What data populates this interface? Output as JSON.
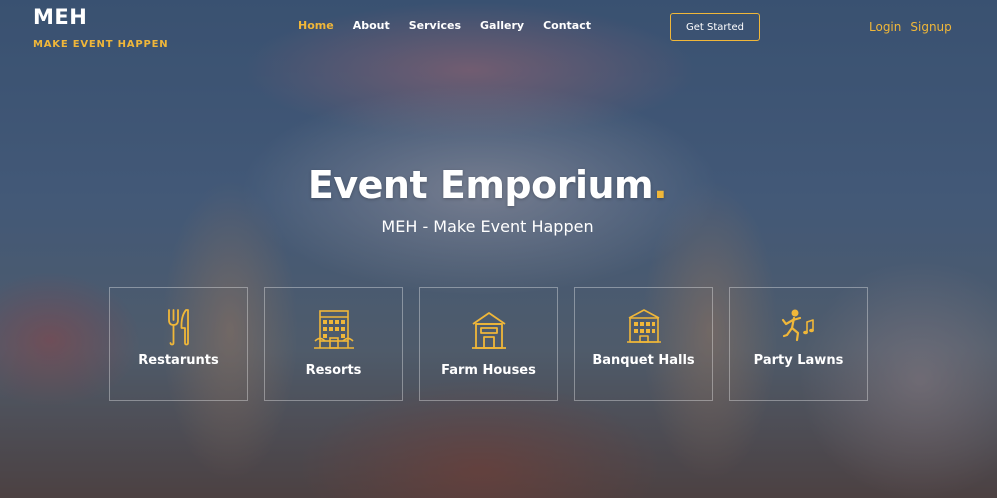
{
  "brand": {
    "name": "MEH",
    "tagline": "MAKE EVENT HAPPEN"
  },
  "nav": {
    "items": [
      {
        "label": "Home",
        "active": true
      },
      {
        "label": "About",
        "active": false
      },
      {
        "label": "Services",
        "active": false
      },
      {
        "label": "Gallery",
        "active": false
      },
      {
        "label": "Contact",
        "active": false
      }
    ]
  },
  "cta": {
    "label": "Get Started"
  },
  "auth": {
    "login": "Login",
    "signup": "Signup"
  },
  "hero": {
    "title": "Event Emporium",
    "title_dot": ".",
    "subtitle": "MEH - Make Event Happen"
  },
  "categories": [
    {
      "label": "Restarunts",
      "icon": "fork-knife-icon"
    },
    {
      "label": "Resorts",
      "icon": "resort-building-icon"
    },
    {
      "label": "Farm Houses",
      "icon": "farm-house-icon"
    },
    {
      "label": "Banquet Halls",
      "icon": "banquet-hall-icon"
    },
    {
      "label": "Party Lawns",
      "icon": "dancing-person-icon"
    }
  ],
  "colors": {
    "accent": "#f0b739",
    "text": "#ffffff"
  }
}
